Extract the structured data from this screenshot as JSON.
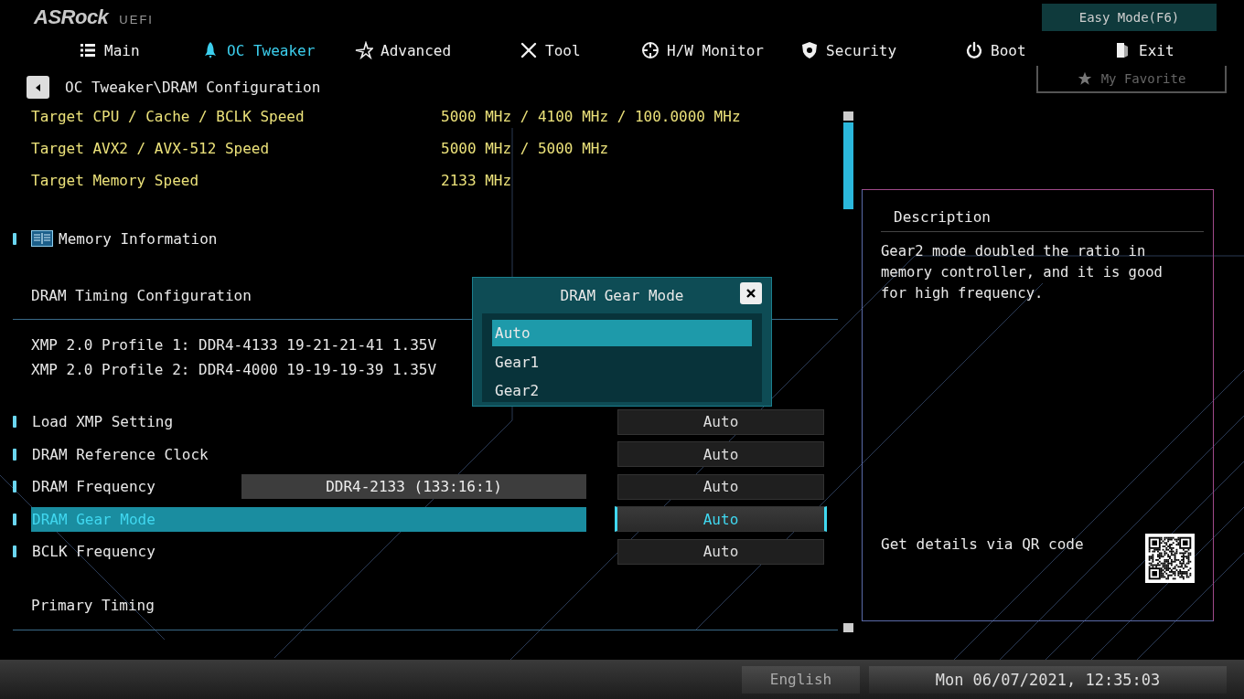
{
  "logo": {
    "brand": "ASRock",
    "suffix": "UEFI"
  },
  "easy_mode": "Easy Mode(F6)",
  "my_favorite": "My Favorite",
  "tabs": [
    {
      "label": "Main",
      "selected": false
    },
    {
      "label": "OC Tweaker",
      "selected": true
    },
    {
      "label": "Advanced",
      "selected": false
    },
    {
      "label": "Tool",
      "selected": false
    },
    {
      "label": "H/W Monitor",
      "selected": false
    },
    {
      "label": "Security",
      "selected": false
    },
    {
      "label": "Boot",
      "selected": false
    },
    {
      "label": "Exit",
      "selected": false
    }
  ],
  "breadcrumb": "OC Tweaker\\DRAM Configuration",
  "info_rows": [
    {
      "label": "Target CPU / Cache / BCLK Speed",
      "value": "5000 MHz / 4100 MHz / 100.0000 MHz"
    },
    {
      "label": "Target AVX2 / AVX-512 Speed",
      "value": "5000 MHz / 5000 MHz"
    },
    {
      "label": "Target Memory Speed",
      "value": "2133 MHz"
    }
  ],
  "items": [
    {
      "kind": "submenu",
      "label": "Memory Information"
    },
    {
      "kind": "heading",
      "label": "DRAM Timing Configuration"
    },
    {
      "kind": "text",
      "label": "XMP 2.0 Profile 1: DDR4-4133 19-21-21-41 1.35V"
    },
    {
      "kind": "text",
      "label": "XMP 2.0 Profile 2: DDR4-4000 19-19-19-39 1.35V"
    },
    {
      "kind": "setting",
      "label": "Load XMP Setting",
      "value": "Auto",
      "selected": false
    },
    {
      "kind": "setting",
      "label": "DRAM Reference Clock",
      "value": "Auto",
      "selected": false
    },
    {
      "kind": "setting",
      "label": "DRAM Frequency",
      "info": "DDR4-2133 (133:16:1)",
      "value": "Auto",
      "selected": false
    },
    {
      "kind": "setting",
      "label": "DRAM Gear Mode",
      "value": "Auto",
      "selected": true
    },
    {
      "kind": "setting",
      "label": "BCLK Frequency",
      "value": "Auto",
      "selected": false
    },
    {
      "kind": "heading",
      "label": "Primary Timing"
    }
  ],
  "popup": {
    "title": "DRAM Gear Mode",
    "options": [
      {
        "label": "Auto",
        "selected": true
      },
      {
        "label": "Gear1",
        "selected": false
      },
      {
        "label": "Gear2",
        "selected": false
      }
    ]
  },
  "description": {
    "title": "Description",
    "text": "Gear2 mode doubled the ratio in memory controller, and it is good for high frequency.",
    "qr_caption": "Get details via QR code"
  },
  "status_bar": {
    "language": "English",
    "datetime": "Mon 06/07/2021, 12:35:03"
  }
}
